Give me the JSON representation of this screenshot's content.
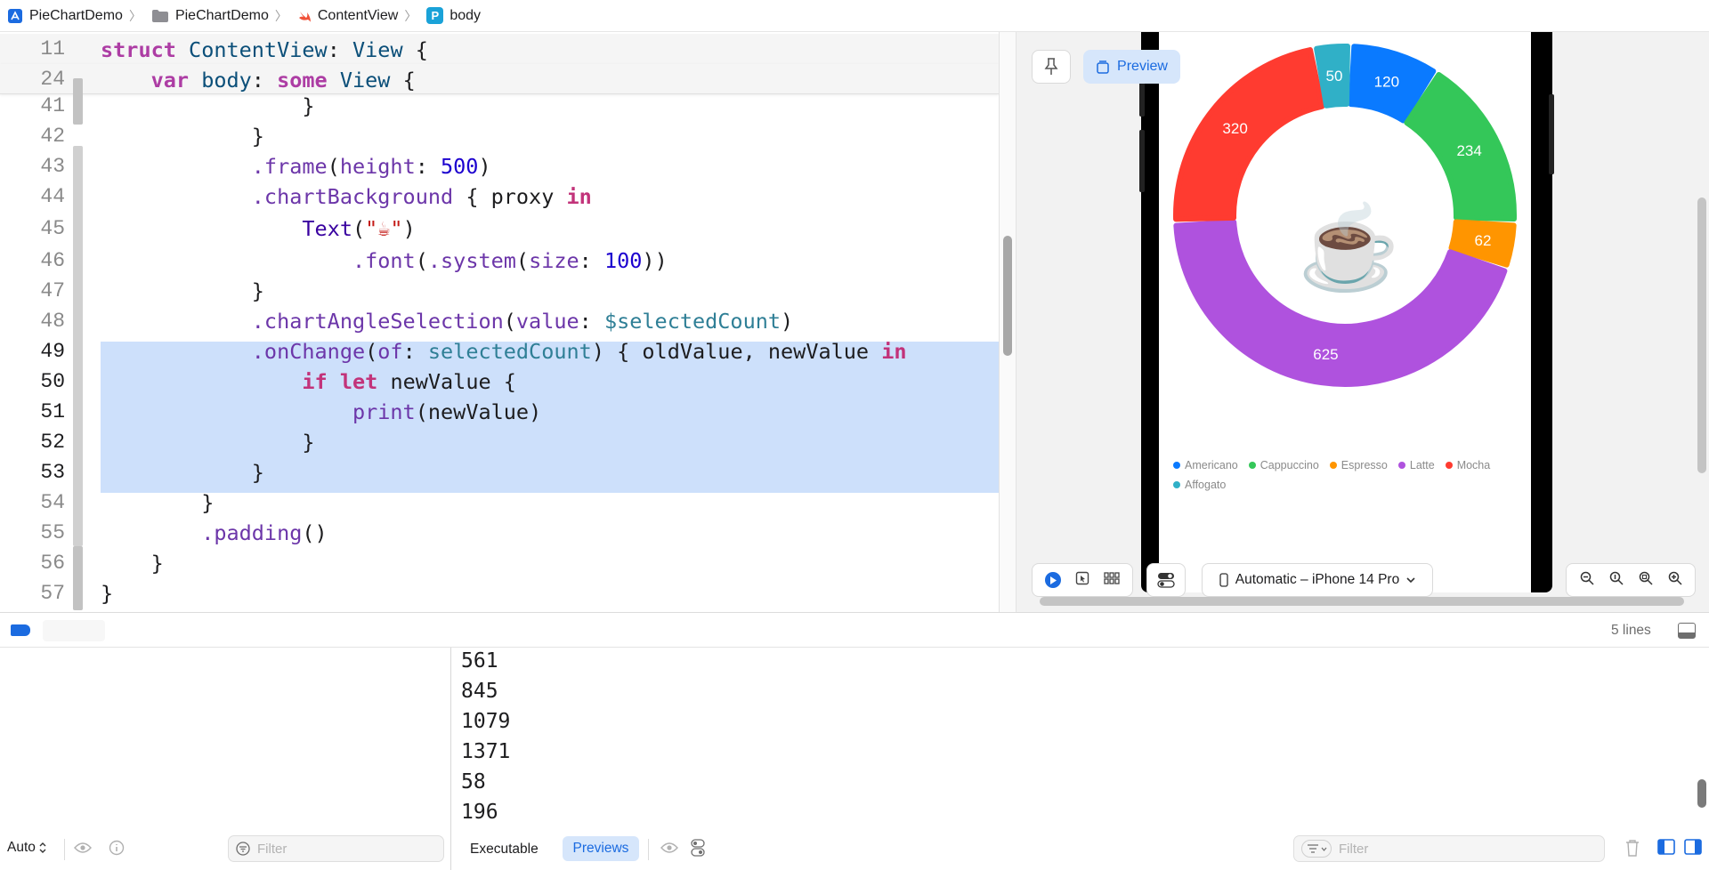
{
  "jumpbar": {
    "project": "PieChartDemo",
    "folder": "PieChartDemo",
    "file": "ContentView",
    "symbol": "body",
    "symbol_badge": "P"
  },
  "editor": {
    "sticky": [
      {
        "num": "11"
      },
      {
        "num": "24"
      }
    ],
    "lines": [
      {
        "num": "41"
      },
      {
        "num": "42"
      },
      {
        "num": "43"
      },
      {
        "num": "44"
      },
      {
        "num": "45"
      },
      {
        "num": "46"
      },
      {
        "num": "47"
      },
      {
        "num": "48"
      },
      {
        "num": "49"
      },
      {
        "num": "50"
      },
      {
        "num": "51"
      },
      {
        "num": "52"
      },
      {
        "num": "53"
      },
      {
        "num": "54"
      },
      {
        "num": "55"
      },
      {
        "num": "56"
      },
      {
        "num": "57"
      }
    ],
    "tokens": {
      "struct": "struct",
      "ContentView": "ContentView",
      "colon": ":",
      "View": "View",
      "brace": "{",
      "var": "var",
      "body": "body",
      "some": "some",
      "close": "}",
      "frame": ".frame",
      "height": "height",
      "n500": "500",
      "chartBackground": ".chartBackground",
      "proxy_in": "{ proxy ",
      "in": "in",
      "Text": "Text",
      "cup_str": "\"☕\"",
      "font": ".font",
      "system": ".system",
      "size": "size",
      "n100": "100",
      "chartAngleSelection": ".chartAngleSelection",
      "value": "value",
      "selectedCountBinding": "$selectedCount",
      "onChange": ".onChange",
      "of": "of",
      "selectedCount": "selectedCount",
      "oldnew": "{ oldValue, newValue ",
      "if": "if",
      "let": "let",
      "newValue": "newValue",
      "print": "print",
      "padding": ".padding",
      "parens": "()"
    }
  },
  "canvas": {
    "preview_label": "Preview",
    "device": "Automatic – iPhone 14 Pro",
    "center_emoji": "☕",
    "legend": [
      {
        "name": "Americano",
        "color": "#0a7aff"
      },
      {
        "name": "Cappuccino",
        "color": "#34c759"
      },
      {
        "name": "Espresso",
        "color": "#ff9500"
      },
      {
        "name": "Latte",
        "color": "#af52de"
      },
      {
        "name": "Mocha",
        "color": "#ff3b30"
      },
      {
        "name": "Affogato",
        "color": "#30b0c7"
      }
    ]
  },
  "chart_data": {
    "type": "pie",
    "categories": [
      "Americano",
      "Cappuccino",
      "Espresso",
      "Latte",
      "Mocha",
      "Affogato"
    ],
    "values": [
      120,
      234,
      62,
      625,
      320,
      50
    ],
    "colors": [
      "#0a7aff",
      "#34c759",
      "#ff9500",
      "#af52de",
      "#ff3b30",
      "#30b0c7"
    ],
    "legend": "bottom"
  },
  "debug": {
    "lines_count": "5 lines"
  },
  "vars": {
    "mode": "Auto",
    "filter_placeholder": "Filter"
  },
  "console": {
    "output": [
      "561",
      "845",
      "1079",
      "1371",
      "58",
      "196"
    ],
    "tab_executable": "Executable",
    "tab_previews": "Previews",
    "filter_placeholder": "Filter"
  }
}
